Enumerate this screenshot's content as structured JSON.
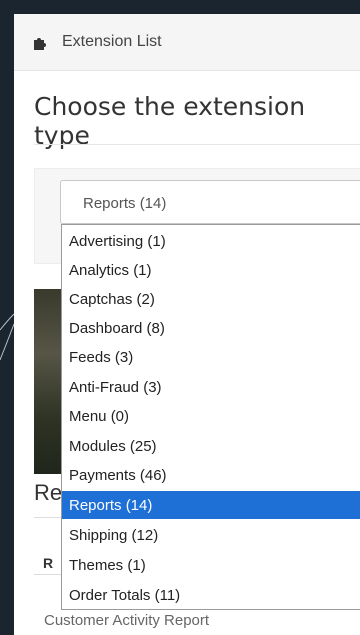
{
  "header": {
    "title": "Extension List",
    "icon": "puzzle-icon"
  },
  "section_title": "Choose the extension type",
  "select": {
    "value": "Reports (14)"
  },
  "dropdown": {
    "selected": "Reports (14)",
    "options": [
      "Advertising (1)",
      "Analytics (1)",
      "Captchas (2)",
      "Dashboard (8)",
      "Feeds (3)",
      "Anti-Fraud (3)",
      "Menu (0)",
      "Modules (25)",
      "Payments (46)",
      "Reports (14)",
      "Shipping (12)",
      "Themes (1)",
      "Order Totals (11)"
    ]
  },
  "background_content": {
    "partial_heading": "Re",
    "table_header": "R",
    "row_text": "Customer Activity Report"
  },
  "colors": {
    "selected_bg": "#1e6fd6",
    "page_bg": "#1b2530"
  }
}
